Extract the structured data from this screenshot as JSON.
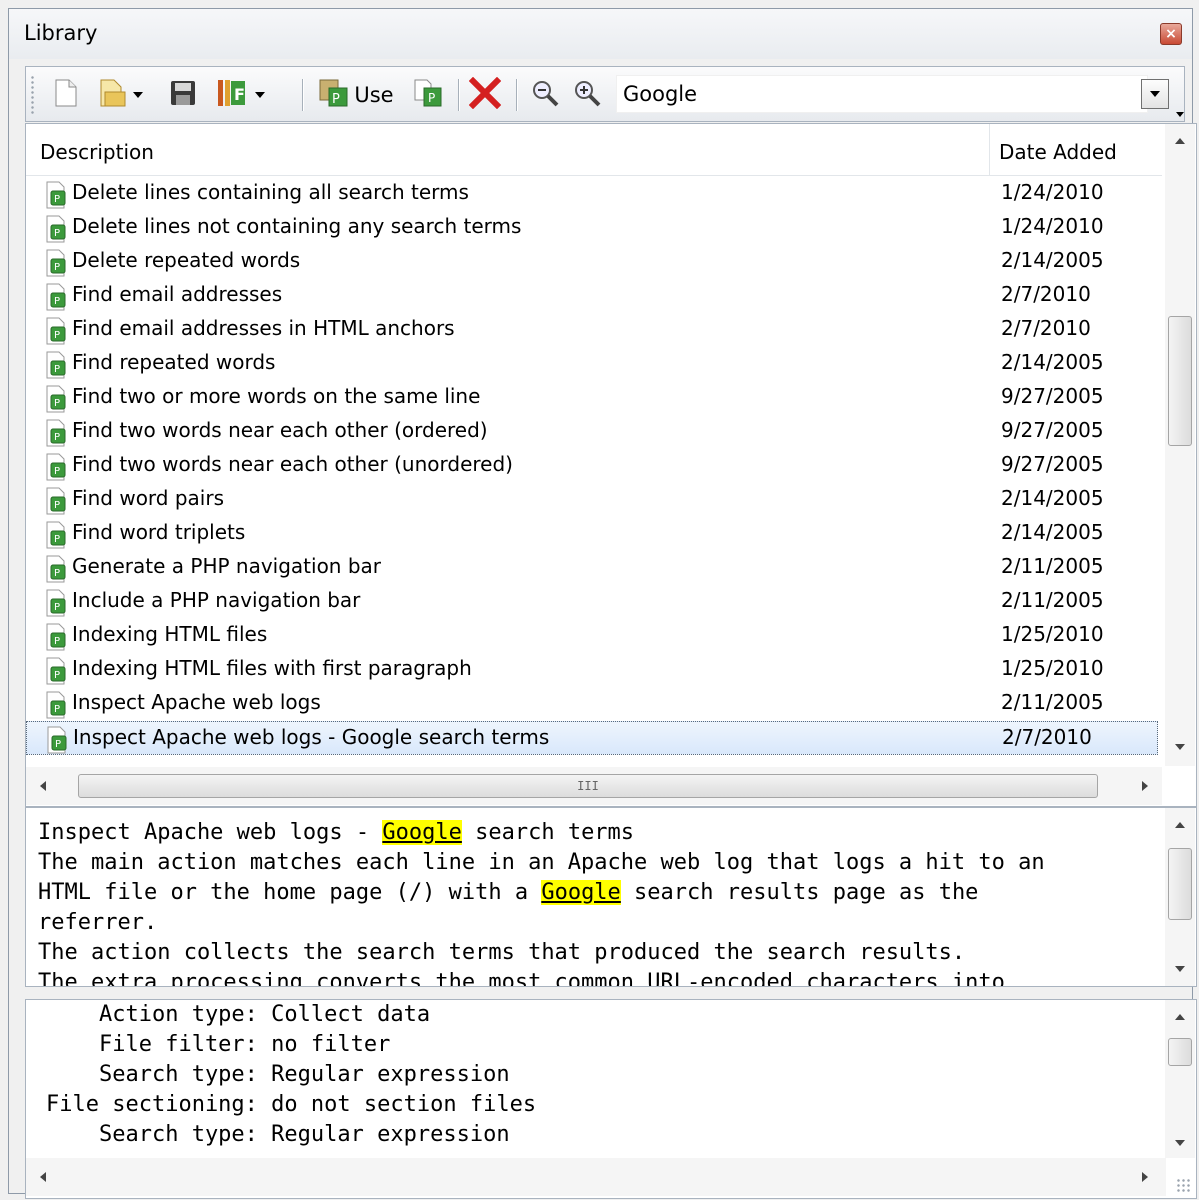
{
  "window": {
    "title": "Library",
    "close_glyph": "×"
  },
  "toolbar": {
    "icons": [
      "new-icon",
      "open-icon",
      "save-icon",
      "format-icon",
      "use-icon",
      "copy-icon",
      "delete-icon",
      "zoom-out-icon",
      "zoom-in-icon"
    ],
    "use_label": "Use",
    "search_value": "Google"
  },
  "list": {
    "columns": {
      "description": "Description",
      "date_added": "Date Added"
    },
    "rows": [
      {
        "description": "Delete lines containing all search terms",
        "date": "1/24/2010"
      },
      {
        "description": "Delete lines not containing any search terms",
        "date": "1/24/2010"
      },
      {
        "description": "Delete repeated words",
        "date": "2/14/2005"
      },
      {
        "description": "Find email addresses",
        "date": "2/7/2010"
      },
      {
        "description": "Find email addresses in HTML anchors",
        "date": "2/7/2010"
      },
      {
        "description": "Find repeated words",
        "date": "2/14/2005"
      },
      {
        "description": "Find two or more words on the same line",
        "date": "9/27/2005"
      },
      {
        "description": "Find two words near each other (ordered)",
        "date": "9/27/2005"
      },
      {
        "description": "Find two words near each other (unordered)",
        "date": "9/27/2005"
      },
      {
        "description": "Find word pairs",
        "date": "2/14/2005"
      },
      {
        "description": "Find word triplets",
        "date": "2/14/2005"
      },
      {
        "description": "Generate a PHP navigation bar",
        "date": "2/11/2005"
      },
      {
        "description": "Include a PHP navigation bar",
        "date": "2/11/2005"
      },
      {
        "description": "Indexing HTML files",
        "date": "1/25/2010"
      },
      {
        "description": "Indexing HTML files with first paragraph",
        "date": "1/25/2010"
      },
      {
        "description": "Inspect Apache web logs",
        "date": "2/11/2005"
      },
      {
        "description": "Inspect Apache web logs - Google search terms",
        "date": "2/7/2010"
      }
    ],
    "selected_index": 16,
    "hscroll_grip": "III"
  },
  "description_panel": {
    "line1_before": "Inspect Apache web logs - ",
    "line1_highlight": "Google",
    "line1_after": " search terms",
    "line2": "The main action matches each line in an Apache web log that logs a hit to an",
    "line3_before": "HTML file or the home page (/) with a ",
    "line3_highlight": "Google",
    "line3_after": " search results page as the",
    "line4": "referrer.",
    "line5": "The action collects the search terms that produced the search results.",
    "line6": "The extra processing converts the most common URL-encoded characters into"
  },
  "properties_panel": {
    "lines": [
      "    Action type: Collect data",
      "    File filter: no filter",
      "    Search type: Regular expression",
      "File sectioning: do not section files",
      "    Search type: Regular expression"
    ]
  },
  "colors": {
    "highlight": "#ffff00",
    "selection": "#d9e8fb",
    "delete_red": "#d42020",
    "icon_green": "#3c9a3c"
  }
}
